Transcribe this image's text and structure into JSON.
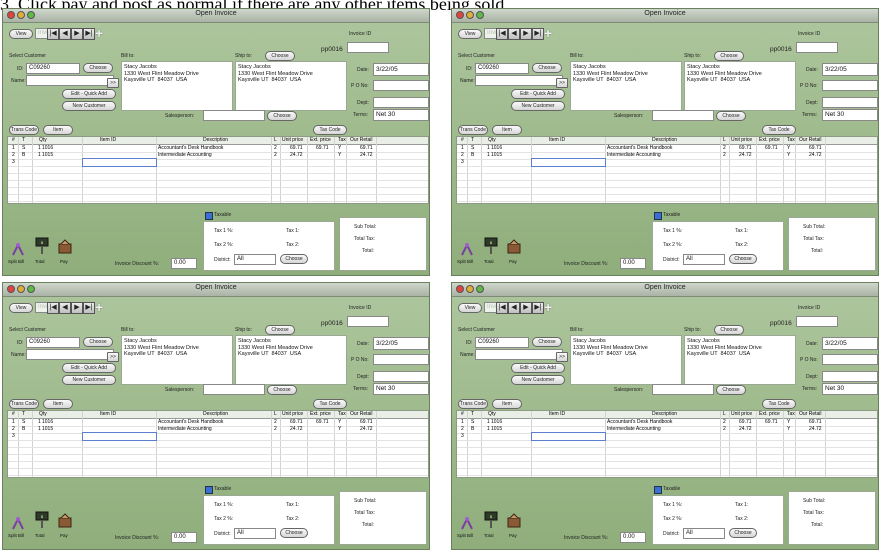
{
  "document": {
    "header_text": "3. Click pay and post as normal if there are any other items being sold."
  },
  "window": {
    "title": "Open Invoice",
    "toolbar": {
      "view_label": "View",
      "invoice_search_placeholder": "Invoice ID",
      "nav_first": "|◀",
      "nav_prev": "◀",
      "nav_next": "▶",
      "nav_last": "▶|",
      "add_label": "+"
    },
    "invoice": {
      "id_label": "Invoice ID",
      "id_value": "pp0016"
    },
    "customer": {
      "section_label": "Select Customer",
      "id_label": "ID:",
      "id_value": "C09260",
      "choose_label": "Choose",
      "name_label": "Name:",
      "name_value": "",
      "more_label": ">>",
      "edit_quick_add_label": "Edit - Quick Add",
      "new_customer_label": "New Customer"
    },
    "bill_to": {
      "label": "Bill to:",
      "lines": "Stacy Jacobs\n1330 West Flint Meadow Drive\nKaysville UT  84037  USA"
    },
    "ship_to": {
      "label": "Ship to:",
      "choose_label": "Choose",
      "lines": "Stacy Jacobs\n1330 West Flint Meadow Drive\nKaysville UT  84037  USA"
    },
    "details": {
      "date_label": "Date:",
      "date_value": "3/22/05",
      "po_label": "P O No:",
      "po_value": "",
      "dept_label": "Dept:",
      "dept_value": "",
      "terms_label": "Terms:",
      "terms_value": "Net 30"
    },
    "salesperson": {
      "label": "Salesperson:",
      "value": "",
      "choose_label": "Choose"
    },
    "buttons": {
      "trans_code": "Trans Code",
      "item": "Item",
      "tax_code": "Tax Code"
    },
    "grid": {
      "columns": [
        "#",
        "T",
        "Qty",
        "Item ID",
        "Description",
        "L",
        "Unit price",
        "Ext. price",
        "Tax",
        "Our Retail"
      ],
      "rows": [
        {
          "num": "1",
          "type": "S",
          "qty": "1",
          "item_id": "1016",
          "desc": "Accountant's Desk Handbook",
          "l": "2",
          "unit": "69.71",
          "ext": "69.71",
          "tax": "Y",
          "retail": "69.71"
        },
        {
          "num": "2",
          "type": "B",
          "qty": "1",
          "item_id": "1015",
          "desc": "Intermediate Accounting",
          "l": "2",
          "unit": "24.72",
          "ext": "",
          "tax": "Y",
          "retail": "24.72"
        },
        {
          "num": "3",
          "type": "",
          "qty": "",
          "item_id": "",
          "desc": "",
          "l": "",
          "unit": "",
          "ext": "",
          "tax": "",
          "retail": ""
        }
      ]
    },
    "footer": {
      "taxable_label": "Taxable",
      "tax1_pct_label": "Tax 1 %:",
      "tax1_label": "Tax 1:",
      "tax2_pct_label": "Tax 2 %:",
      "tax2_label": "Tax 2:",
      "district_label": "District:",
      "district_value": "All",
      "district_choose": "Choose",
      "subtotal_label": "Sub Total:",
      "total_tax_label": "Total Tax:",
      "total_label": "Total:",
      "invoice_discount_label": "Invoice Discount %:",
      "invoice_discount_value": "0.00"
    },
    "actions": {
      "split_bill": "Split Bill",
      "total": "Total",
      "pay": "Pay"
    }
  },
  "colors": {
    "window_green": "#9bb889",
    "accent_blue": "#5a7fd0"
  }
}
